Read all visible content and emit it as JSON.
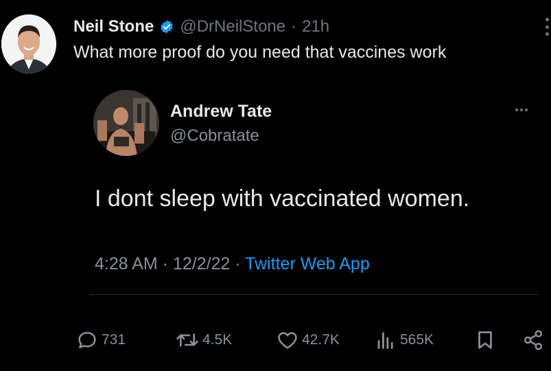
{
  "tweet": {
    "author_name": "Neil Stone",
    "handle": "@DrNeilStone",
    "separator": "·",
    "time": "21h",
    "text": "What more proof do you need that vaccines work"
  },
  "quoted_tweet": {
    "author_name": "Andrew Tate",
    "handle": "@Cobratate",
    "text": "I dont sleep with vaccinated women.",
    "time": "4:28 AM",
    "date": "12/2/22",
    "separator": "·",
    "source": "Twitter Web App"
  },
  "actions": {
    "replies": "731",
    "retweets": "4.5K",
    "likes": "42.7K",
    "views": "565K"
  },
  "colors": {
    "background": "#000000",
    "text": "#e7e9ea",
    "muted": "#71767b",
    "link": "#1d9bf0"
  },
  "icons": {
    "verified": "verified-badge-icon",
    "more": "more-vertical-icon",
    "reply": "speech-bubble-icon",
    "retweet": "retweet-icon",
    "like": "heart-icon",
    "views": "bar-chart-icon",
    "bookmark": "bookmark-icon",
    "share": "share-nodes-icon"
  }
}
